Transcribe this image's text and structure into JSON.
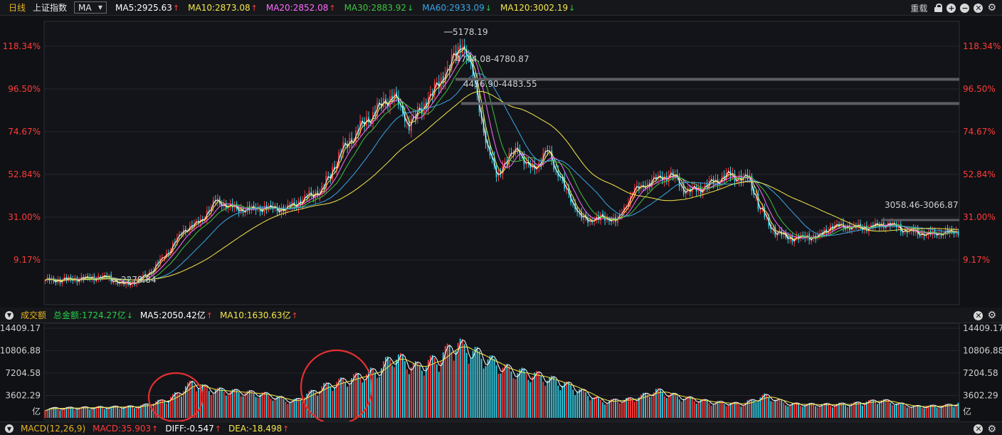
{
  "header": {
    "period": "日线",
    "index_name": "上证指数",
    "indicator": "MA",
    "ma_items": [
      {
        "text": "MA5:2925.63",
        "arrow": "↑",
        "color": "#ffffff",
        "arrow_color": "#ff3b3b"
      },
      {
        "text": "MA10:2873.08",
        "arrow": "↑",
        "color": "#f4e84a",
        "arrow_color": "#ff3b3b"
      },
      {
        "text": "MA20:2852.08",
        "arrow": "↑",
        "color": "#ff6cff",
        "arrow_color": "#ff3b3b"
      },
      {
        "text": "MA30:2883.92",
        "arrow": "↓",
        "color": "#3ec43e",
        "arrow_color": "#27d04a"
      },
      {
        "text": "MA60:2933.09",
        "arrow": "↓",
        "color": "#3aa6e8",
        "arrow_color": "#27d04a"
      },
      {
        "text": "MA120:3002.19",
        "arrow": "↓",
        "color": "#f4e84a",
        "arrow_color": "#27d04a"
      }
    ],
    "tools": {
      "rebuild": "重载",
      "zoom_in": "+",
      "zoom_out": "−"
    }
  },
  "price_panel": {
    "axis_labels": [
      "118.34%",
      "96.50%",
      "74.67%",
      "52.84%",
      "31.00%",
      "9.17%"
    ],
    "axis_fractions": [
      1.1834,
      0.965,
      0.7467,
      0.5284,
      0.31,
      0.0917
    ],
    "annotations": {
      "high": "5178.19",
      "low": "2279.84",
      "gap_upper": "4744.08-4780.87",
      "gap_lower": "4456.90-4483.55",
      "gap_recent": "3058.46-3066.87"
    },
    "gap_values": {
      "upper": 4762,
      "lower": 4470,
      "recent": 3062
    },
    "base_price": 2363.9,
    "colors": {
      "up": "#ff3b3b",
      "down": "#33d3e8",
      "ma5": "#ffffff",
      "ma10": "#f4e84a",
      "ma20": "#ff6cff",
      "ma30": "#3ec43e",
      "ma60": "#3aa6e8",
      "ma120": "#f4e84a",
      "axis_text": "#ff3b3b"
    }
  },
  "volume_panel": {
    "title": "成交额",
    "total": "总金额:1724.27亿",
    "total_arrow": "↓",
    "ma5": "MA5:2050.42亿",
    "ma5_arrow": "↑",
    "ma10": "MA10:1630.63亿",
    "ma10_arrow": "↑",
    "axis_labels": [
      "14409.17",
      "10806.88",
      "7204.58",
      "3602.29",
      "亿"
    ],
    "axis_values": [
      14409.17,
      10806.88,
      7204.58,
      3602.29
    ]
  },
  "macd_panel": {
    "title": "MACD(12,26,9)",
    "macd": "MACD:35.903",
    "macd_arrow": "↑",
    "diff": "DIFF:-0.547",
    "diff_arrow": "↑",
    "dea": "DEA:-18.498",
    "dea_arrow": "↑"
  }
}
